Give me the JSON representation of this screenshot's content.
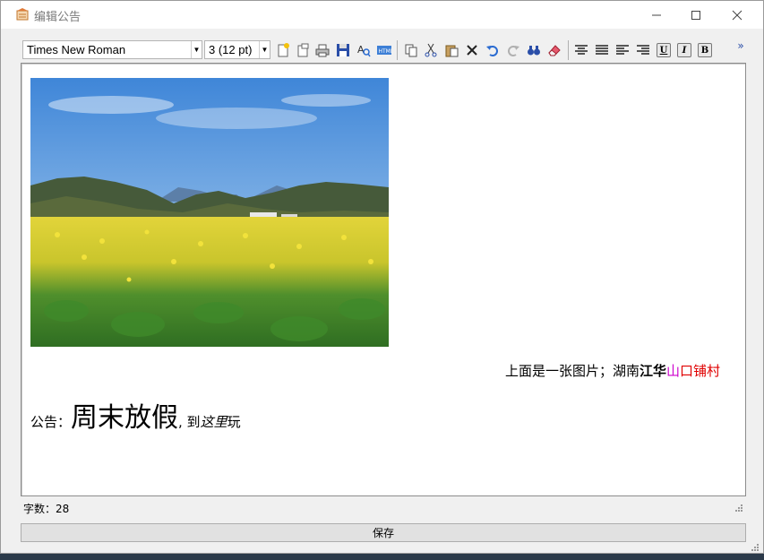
{
  "window": {
    "title": "编辑公告"
  },
  "toolbar": {
    "font_name": "Times New Roman",
    "font_size": "3 (12 pt)",
    "more": "»",
    "underline": "U",
    "italic": "I",
    "bold": "B"
  },
  "editor": {
    "caption": {
      "part1": "上面是一张图片；湖南",
      "part2_bold": "江华",
      "part3_magenta": "山",
      "part4_red": "口铺村"
    },
    "notice": {
      "prefix": "公告：",
      "big": "周末放假",
      "mid": ", 到",
      "italic": "这里",
      "suffix": "玩"
    },
    "colors": {
      "magenta": "#cc00cc",
      "red": "#e00000"
    }
  },
  "status": {
    "word_count": "字数：28"
  },
  "save_label": "保存"
}
